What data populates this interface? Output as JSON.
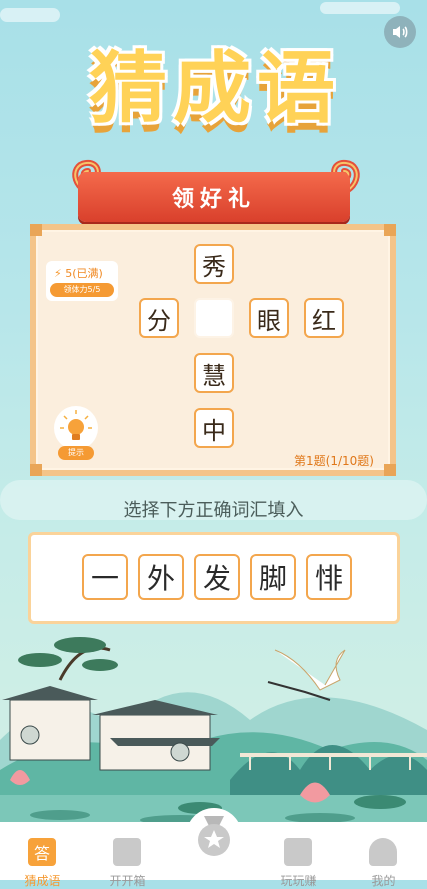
{
  "title": "猜成语",
  "banner": "领好礼",
  "energy": {
    "count": "5(已满)",
    "button": "领体力5/5"
  },
  "hint_label": "提示",
  "progress": "第1题(1/10题)",
  "grid": [
    {
      "char": "秀"
    },
    {
      "char": "分"
    },
    {
      "char": ""
    },
    {
      "char": "眼"
    },
    {
      "char": "红"
    },
    {
      "char": "慧"
    },
    {
      "char": "中"
    }
  ],
  "instruction": "选择下方正确词汇填入",
  "options": [
    "一",
    "外",
    "发",
    "脚",
    "悱"
  ],
  "tabs": [
    {
      "label": "猜成语",
      "icon": "answer-icon"
    },
    {
      "label": "开开箱",
      "icon": "gift-box-icon"
    },
    {
      "label": "",
      "icon": "medal-icon"
    },
    {
      "label": "玩玩赚",
      "icon": "phone-icon"
    },
    {
      "label": "我的",
      "icon": "user-icon"
    }
  ],
  "colors": {
    "accent": "#f59a33",
    "ribbon": "#e04a32",
    "cell_border": "#f3a64d",
    "title": "#ffd257"
  }
}
